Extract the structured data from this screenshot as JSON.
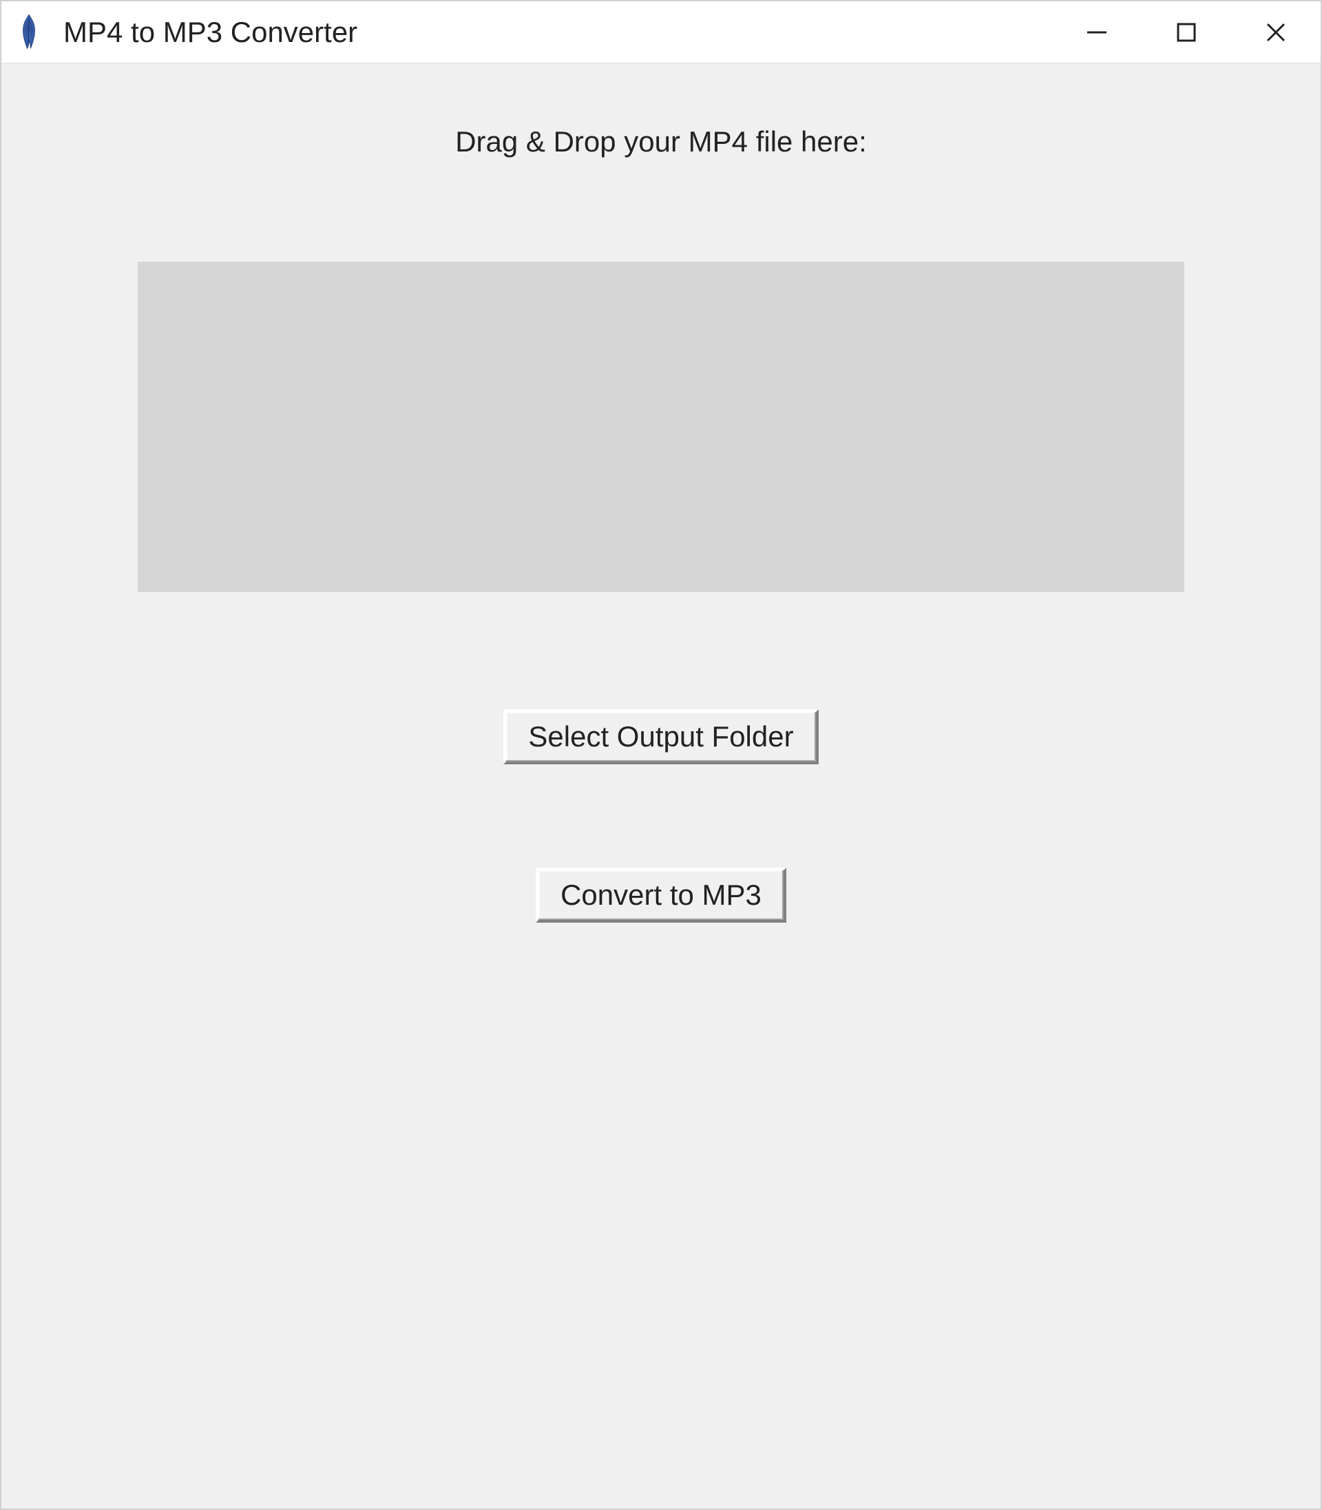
{
  "window": {
    "title": "MP4 to MP3 Converter"
  },
  "main": {
    "instruction": "Drag & Drop your MP4 file here:",
    "select_output_label": "Select Output Folder",
    "convert_label": "Convert to MP3"
  }
}
